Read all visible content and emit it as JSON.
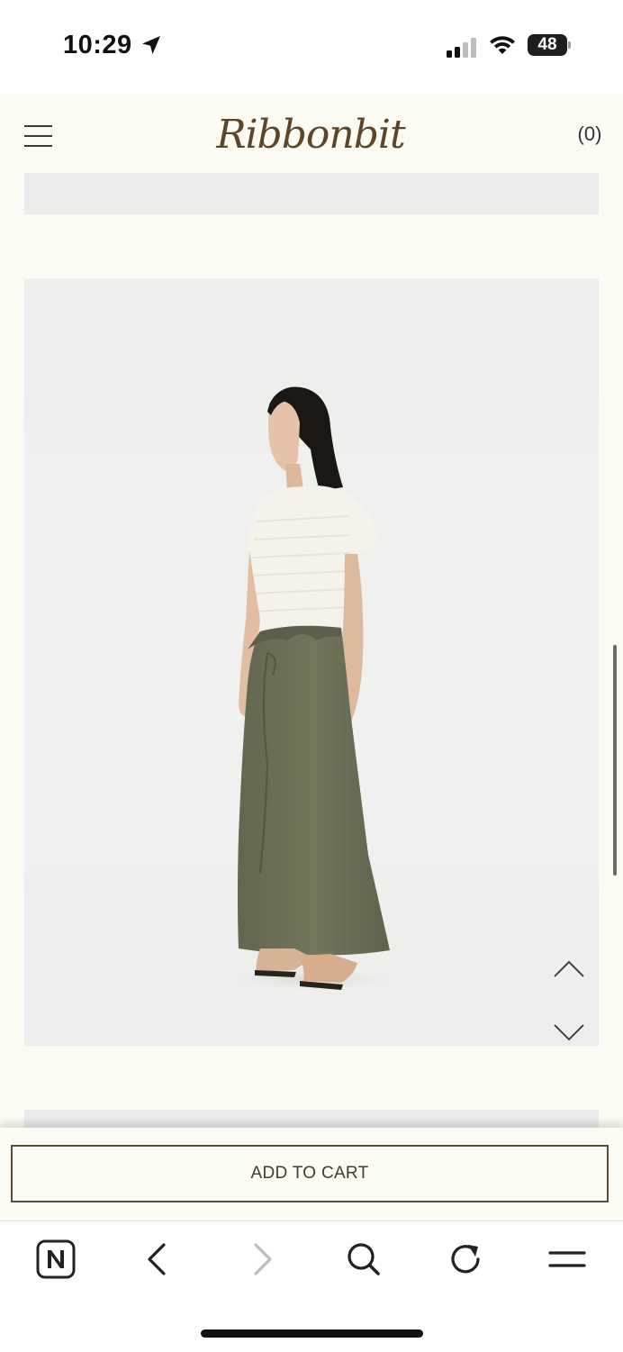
{
  "status_bar": {
    "time": "10:29",
    "battery": "48"
  },
  "header": {
    "logo": "Ribbonbit",
    "cart_count": "(0)"
  },
  "product": {
    "image_alt": "Model wearing white short-sleeve knit top and olive green wrap maxi skirt"
  },
  "actions": {
    "add_to_cart": "ADD TO CART"
  },
  "colors": {
    "background": "#fbfaf3",
    "brand": "#5d4529",
    "button_border": "#5b4a33",
    "skirt": "#6e7258"
  },
  "browser_toolbar": {
    "icons": [
      "naver-n-icon",
      "back-arrow-icon",
      "forward-arrow-icon",
      "search-icon",
      "reload-icon",
      "menu-icon"
    ]
  }
}
